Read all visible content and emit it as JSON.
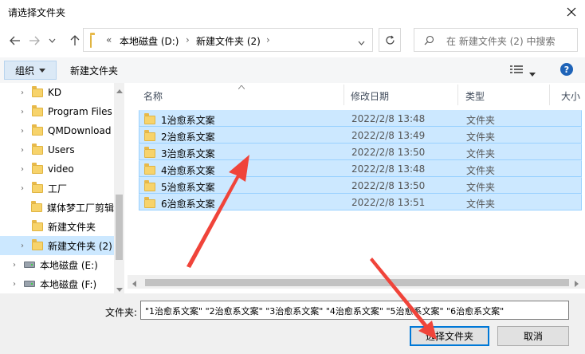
{
  "window": {
    "title": "请选择文件夹"
  },
  "address": {
    "crumb_root": "«",
    "crumbs": [
      "本地磁盘 (D:)",
      "新建文件夹 (2)"
    ]
  },
  "search": {
    "placeholder": "在 新建文件夹 (2) 中搜索"
  },
  "toolbar": {
    "organize_label": "组织",
    "new_folder_label": "新建文件夹"
  },
  "nav_tree": [
    {
      "label": "KD",
      "icon": "folder-icon",
      "selected": false
    },
    {
      "label": "Program Files",
      "icon": "folder-icon",
      "selected": false
    },
    {
      "label": "QMDownload",
      "icon": "folder-icon",
      "selected": false
    },
    {
      "label": "Users",
      "icon": "folder-icon",
      "selected": false
    },
    {
      "label": "video",
      "icon": "folder-icon",
      "selected": false
    },
    {
      "label": "工厂",
      "icon": "folder-icon",
      "selected": false
    },
    {
      "label": "媒体梦工厂剪辑",
      "icon": "folder-icon",
      "selected": false
    },
    {
      "label": "新建文件夹",
      "icon": "folder-icon",
      "selected": false
    },
    {
      "label": "新建文件夹 (2)",
      "icon": "folder-icon",
      "selected": true
    },
    {
      "label": "本地磁盘 (E:)",
      "icon": "drive-icon",
      "selected": false
    },
    {
      "label": "本地磁盘 (F:)",
      "icon": "drive-icon",
      "selected": false
    }
  ],
  "columns": {
    "name": "名称",
    "modified": "修改日期",
    "type": "类型",
    "size": "大小"
  },
  "files": [
    {
      "name": "1治愈系文案",
      "modified": "2022/2/8 13:48",
      "type": "文件夹"
    },
    {
      "name": "2治愈系文案",
      "modified": "2022/2/8 13:49",
      "type": "文件夹"
    },
    {
      "name": "3治愈系文案",
      "modified": "2022/2/8 13:50",
      "type": "文件夹"
    },
    {
      "name": "4治愈系文案",
      "modified": "2022/2/8 13:48",
      "type": "文件夹"
    },
    {
      "name": "5治愈系文案",
      "modified": "2022/2/8 13:50",
      "type": "文件夹"
    },
    {
      "name": "6治愈系文案",
      "modified": "2022/2/8 13:51",
      "type": "文件夹"
    }
  ],
  "footer": {
    "folder_label": "文件夹:",
    "folder_value": "\"1治愈系文案\" \"2治愈系文案\" \"3治愈系文案\" \"4治愈系文案\" \"5治愈系文案\" \"6治愈系文案\"",
    "select_button": "选择文件夹",
    "cancel_button": "取消"
  },
  "colors": {
    "selection": "#cce8ff",
    "selection_border": "#99d1ff",
    "accent": "#0078d7",
    "annotation_arrow": "#f0443a"
  }
}
